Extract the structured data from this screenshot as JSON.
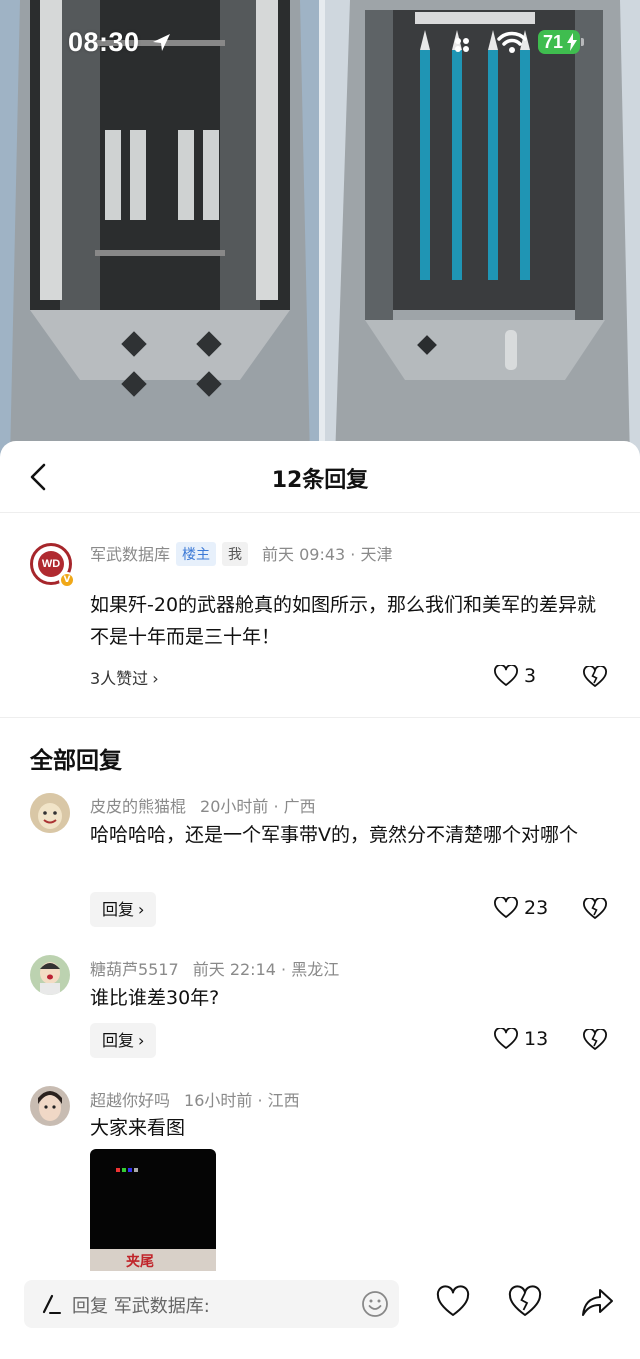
{
  "status_bar": {
    "time": "08:30",
    "battery": "71"
  },
  "sheet": {
    "title": "12条回复"
  },
  "post": {
    "author": "军武数据库",
    "tag_owner": "楼主",
    "tag_me": "我",
    "time_location": "前天 09:43 · 天津",
    "text": "如果歼-20的武器舱真的如图所示，那么我们和美军的差异就不是十年而是三十年！",
    "likers": "3人赞过",
    "likes": "3",
    "avatar_text": "WD"
  },
  "section_title": "全部回复",
  "comments": [
    {
      "author": "皮皮的熊猫棍",
      "time_location": "20小时前 · 广西",
      "text": "哈哈哈哈，还是一个军事带V的，竟然分不清楚哪个对哪个",
      "reply_label": "回复",
      "likes": "23"
    },
    {
      "author": "糖葫芦5517",
      "time_location": "前天 22:14 · 黑龙江",
      "text": "谁比谁差30年?",
      "reply_label": "回复",
      "likes": "13"
    },
    {
      "author": "超越你好吗",
      "time_location": "16小时前 · 江西",
      "text": "大家来看图",
      "image_caption": "夹尾"
    }
  ],
  "bottom_bar": {
    "placeholder": "回复 军武数据库:"
  },
  "icons": {
    "back": "chevron-left-icon",
    "like": "heart-outline-icon",
    "dislike": "broken-heart-icon",
    "share": "share-arrow-icon",
    "emoji": "smile-icon",
    "pen": "pen-icon"
  },
  "colors": {
    "owner_tag_bg": "#e7f0fb",
    "owner_tag_text": "#3d7ad6",
    "battery": "#3fbd4f",
    "avatar_brand": "#b02a30",
    "verified": "#f0a818"
  }
}
